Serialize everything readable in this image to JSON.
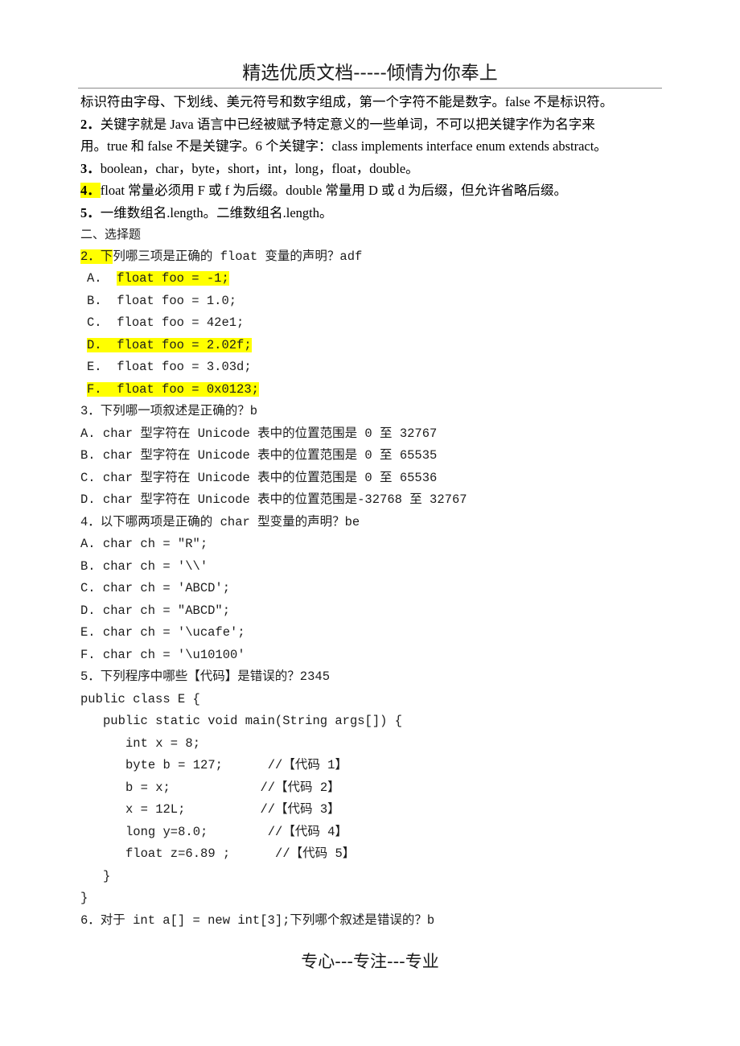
{
  "header": {
    "title": "精选优质文档-----倾情为你奉上"
  },
  "footer": {
    "text": "专心---专注---专业"
  },
  "intro": {
    "line1": "标识符由字母、下划线、美元符号和数字组成，第一个字符不能是数字。false 不是标识符。",
    "item2_num": "2．",
    "item2_line1": "关键字就是 Java 语言中已经被赋予特定意义的一些单词，不可以把关键字作为名字来",
    "item2_line2": "用。true 和 false 不是关键字。6 个关键字：class implements interface enum extends abstract。",
    "item3_num": "3．",
    "item3_text": "boolean，char，byte，short，int，long，float，double。",
    "item4_num": "4．",
    "item4_text": "float 常量必须用 F 或 f 为后缀。double 常量用 D 或 d 为后缀，但允许省略后缀。",
    "item5_num": "5．",
    "item5_text": "一维数组名.length。二维数组名.length。"
  },
  "section2": {
    "heading": "二、选择题",
    "q2": {
      "prefix_highlight": "2．下",
      "rest": "列哪三项是正确的 float 变量的声明？adf",
      "options": [
        {
          "letter": "A.",
          "code": "float foo = -1;",
          "highlight": "code"
        },
        {
          "letter": "B.",
          "code": "float foo = 1.0;",
          "highlight": "none"
        },
        {
          "letter": "C.",
          "code": "float foo = 42e1;",
          "highlight": "none"
        },
        {
          "letter": "D.",
          "code": "float foo = 2.02f;",
          "highlight": "all"
        },
        {
          "letter": "E.",
          "code": "float foo = 3.03d;",
          "highlight": "none"
        },
        {
          "letter": "F.",
          "code": "float foo = 0x0123;",
          "highlight": "all"
        }
      ]
    },
    "q3": {
      "question": "3．下列哪一项叙述是正确的？b",
      "options": [
        "A. char 型字符在 Unicode 表中的位置范围是 0 至 32767",
        "B. char 型字符在 Unicode 表中的位置范围是 0 至 65535",
        "C. char 型字符在 Unicode 表中的位置范围是 0 至 65536",
        "D. char 型字符在 Unicode 表中的位置范围是-32768 至 32767"
      ]
    },
    "q4": {
      "question": "4．以下哪两项是正确的 char 型变量的声明？be",
      "options": [
        "A. char ch = ″R″;",
        "B. char ch = '\\\\'",
        "C. char ch = 'ABCD';",
        "D. char ch = ″ABCD″;",
        "E. char ch = '\\ucafe';",
        "F. char ch = '\\u10100'"
      ]
    },
    "q5": {
      "question": "5．下列程序中哪些【代码】是错误的？2345",
      "code": {
        "class_line": "public class E {",
        "main_line": "public static void main(String args[]) {",
        "stmts": [
          {
            "code": "int x = 8;",
            "comment": ""
          },
          {
            "code": "byte b = 127;",
            "comment": "//【代码 1】"
          },
          {
            "code": "b = x;",
            "comment": "//【代码 2】"
          },
          {
            "code": "x = 12L;",
            "comment": "//【代码 3】"
          },
          {
            "code": "long y=8.0;",
            "comment": "//【代码 4】"
          },
          {
            "code": "float z=6.89 ;",
            "comment": "//【代码 5】"
          }
        ],
        "inner_close": "}",
        "outer_close": "}"
      }
    },
    "q6": {
      "question": "6．对于 int a[] = new int[3];下列哪个叙述是错误的？b"
    }
  }
}
